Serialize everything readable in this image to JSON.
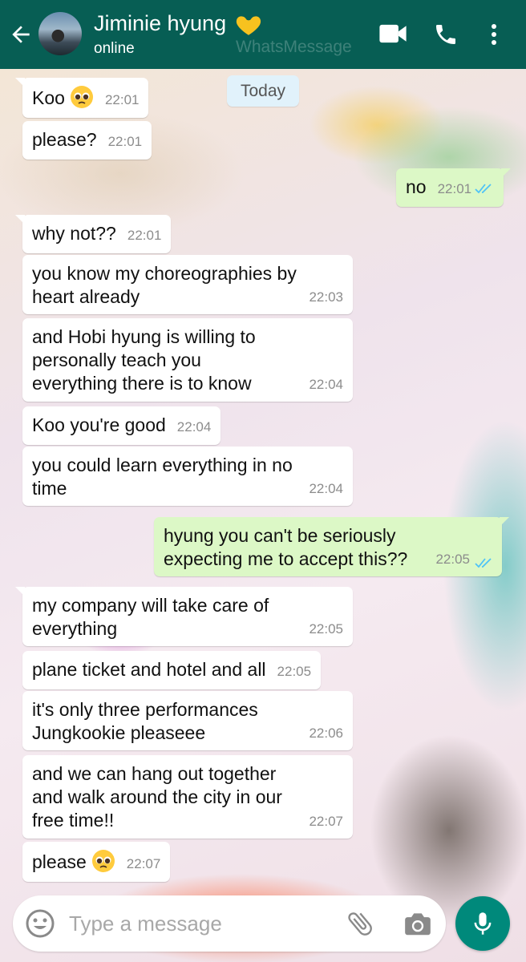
{
  "header": {
    "contact_name": "Jiminie hyung",
    "status": "online",
    "watermark": "WhatsMessage",
    "icons": [
      "back-arrow-icon",
      "yellow-heart-icon",
      "video-call-icon",
      "phone-icon",
      "more-vert-icon"
    ]
  },
  "date_chip": "Today",
  "messages": [
    {
      "dir": "in",
      "text": "Koo",
      "emoji": "pleading-face",
      "time": "22:01"
    },
    {
      "dir": "in",
      "text": "please?",
      "time": "22:01"
    },
    {
      "dir": "out",
      "text": "no",
      "time": "22:01",
      "read": true
    },
    {
      "dir": "in",
      "text": "why not??",
      "time": "22:01"
    },
    {
      "dir": "in",
      "text": "you know my choreographies by heart already",
      "time": "22:03"
    },
    {
      "dir": "in",
      "text": "and Hobi hyung is willing to personally teach you everything there is to know",
      "time": "22:04"
    },
    {
      "dir": "in",
      "text": "Koo you're good",
      "time": "22:04"
    },
    {
      "dir": "in",
      "text": "you could learn everything in no time",
      "time": "22:04"
    },
    {
      "dir": "out",
      "text": "hyung you can't be seriously expecting me to accept this??",
      "time": "22:05",
      "read": true
    },
    {
      "dir": "in",
      "text": "my company will take care of everything",
      "time": "22:05"
    },
    {
      "dir": "in",
      "text": "plane ticket and hotel and all",
      "time": "22:05"
    },
    {
      "dir": "in",
      "text": "it's only three performances Jungkookie pleaseee",
      "time": "22:06"
    },
    {
      "dir": "in",
      "text": "and we can hang out together and walk around the city in our free time!!",
      "time": "22:07"
    },
    {
      "dir": "in",
      "text": "please",
      "emoji": "pleading-face",
      "time": "22:07"
    }
  ],
  "input": {
    "placeholder": "Type a message",
    "value": ""
  },
  "colors": {
    "header": "#075e54",
    "outgoing_bubble": "#dcf8c6",
    "incoming_bubble": "#ffffff",
    "read_ticks": "#4fc3f7",
    "mic_button": "#00897b"
  }
}
